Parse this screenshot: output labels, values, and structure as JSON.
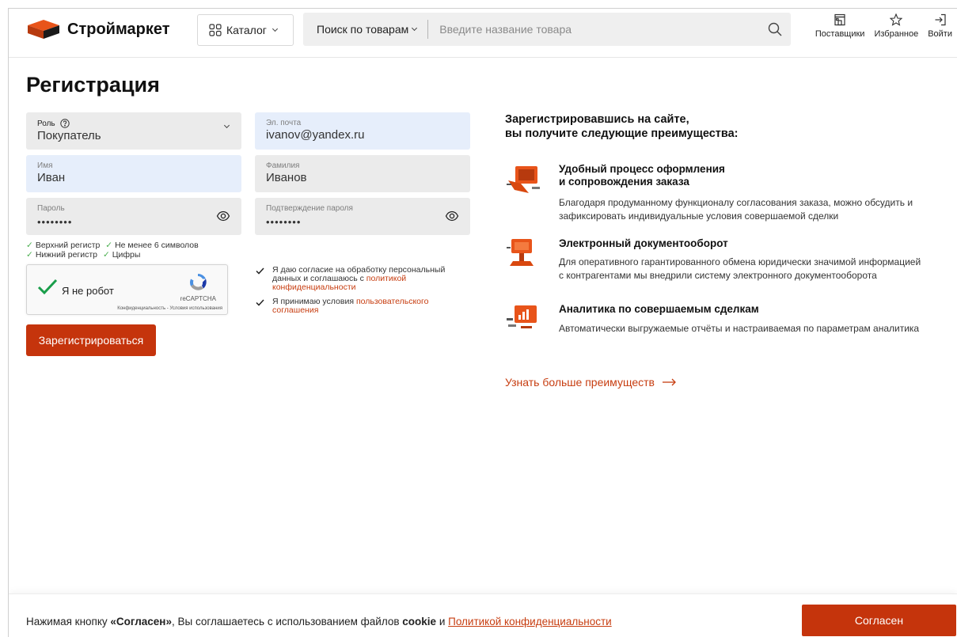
{
  "header": {
    "brand": "Строймаркет",
    "catalog_label": "Каталог",
    "search_mode": "Поиск по товарам",
    "search_placeholder": "Введите название товара",
    "actions": [
      "Поставщики",
      "Избранное",
      "Войти"
    ]
  },
  "page_title": "Регистрация",
  "form": {
    "role": {
      "label": "Роль",
      "value": "Покупатель"
    },
    "email": {
      "label": "Эл. почта",
      "value": "ivanov@yandex.ru"
    },
    "first_name": {
      "label": "Имя",
      "value": "Иван"
    },
    "last_name": {
      "label": "Фамилия",
      "value": "Иванов"
    },
    "password": {
      "label": "Пароль",
      "value": "••••••••"
    },
    "password_confirm": {
      "label": "Подтверждение пароля",
      "value": "••••••••"
    },
    "hints": {
      "upper": "Верхний регистр",
      "min_len": "Не менее 6 символов",
      "lower": "Нижний регистр",
      "digits": "Цифры"
    },
    "captcha": {
      "label": "Я не робот",
      "brand": "reCAPTCHA",
      "links": "Конфиденциальность - Условия использования"
    },
    "consent1": {
      "text": "Я даю согласие на обработку персональный данных и соглашаюсь с",
      "link": "политикой конфиденциальности"
    },
    "consent2": {
      "text": "Я принимаю условия",
      "link": "пользовательского соглашения"
    },
    "submit_label": "Зарегистрироваться"
  },
  "benefits": {
    "title_line1": "Зарегистрировавшись на сайте,",
    "title_line2": "вы получите следующие преимущества:",
    "items": [
      {
        "title_line1": "Удобный процесс оформления",
        "title_line2": "и сопровождения заказа",
        "desc_line1": "Благодаря продуманному функционалу согласования заказа, можно обсудить и",
        "desc_line2": "зафиксировать индивидуальные условия совершаемой сделки"
      },
      {
        "title_line1": "Электронный документооборот",
        "title_line2": "",
        "desc_line1": "Для оперативного гарантированного обмена юридически значимой информацией",
        "desc_line2": "с контрагентами мы внедрили систему электронного документооборота"
      },
      {
        "title_line1": "Аналитика по совершаемым сделкам",
        "title_line2": "",
        "desc_line1": "Автоматически выгружаемые отчёты и настраиваемая по параметрам аналитика",
        "desc_line2": ""
      }
    ],
    "more_link": "Узнать больше преимуществ"
  },
  "cookie": {
    "text_before": "Нажимая кнопку ",
    "bold_button": "«Согласен»",
    "text_middle": ", Вы соглашаетесь с использованием файлов ",
    "bold_cookie": "cookie",
    "text_and": " и ",
    "link": "Политикой конфиденциальности",
    "button_label": "Согласен"
  },
  "colors": {
    "accent": "#c5340c",
    "link": "#c73d10",
    "field_bg": "#ebebeb",
    "field_focus_bg": "#e6eefb"
  }
}
